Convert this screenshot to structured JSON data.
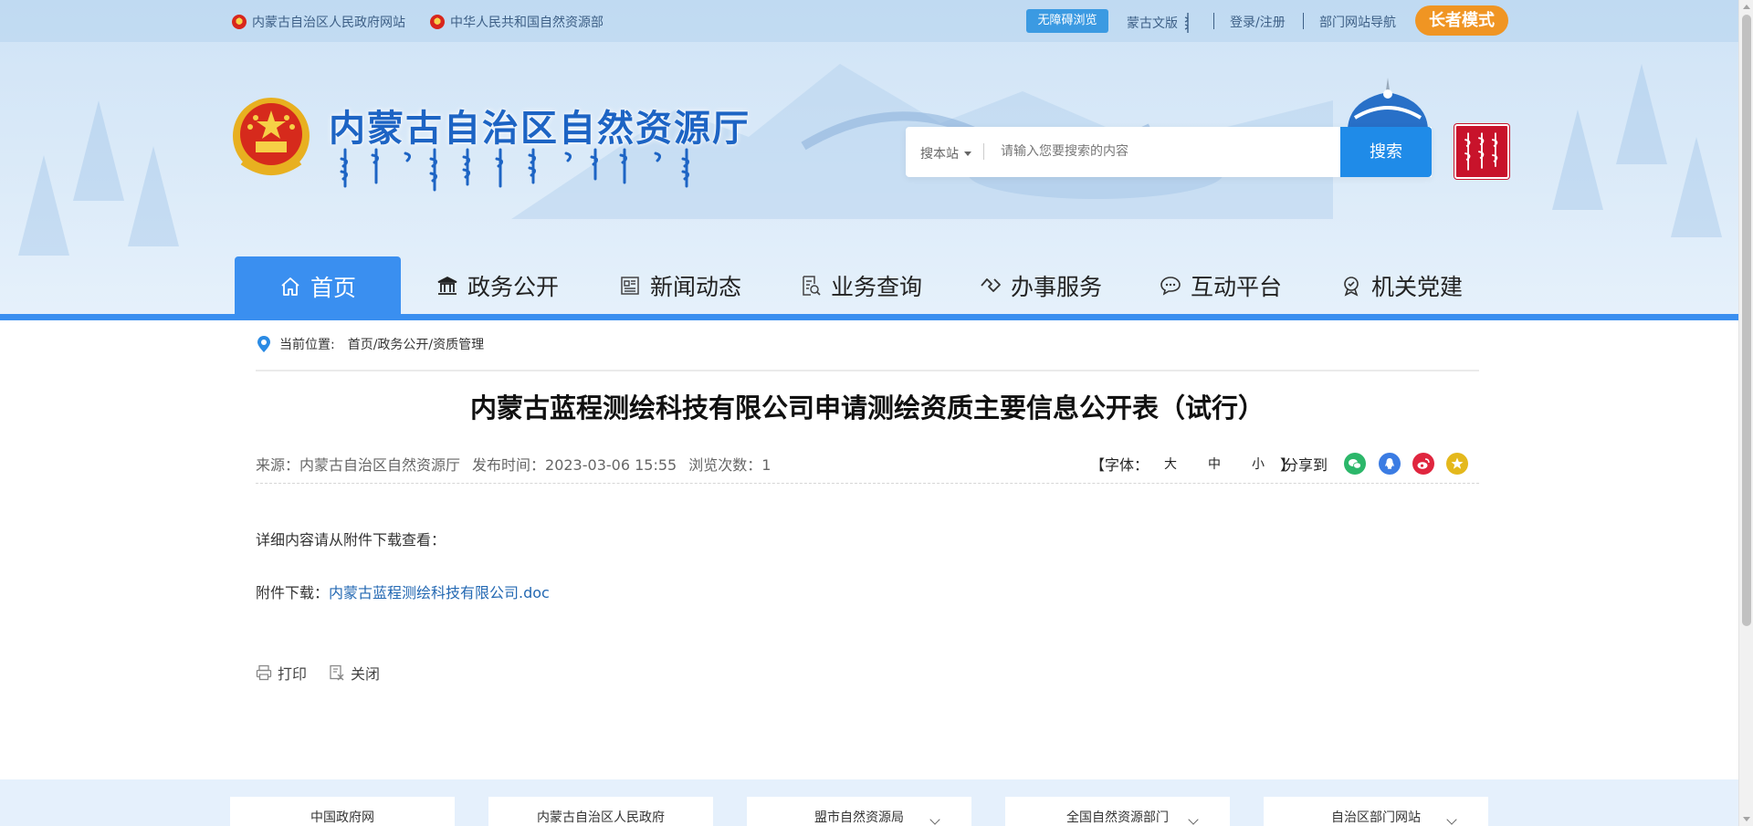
{
  "topbar": {
    "gov_site_link": "内蒙古自治区人民政府网站",
    "ministry_link": "中华人民共和国自然资源部",
    "accessible_btn": "无障碍浏览",
    "mongolian_version": "蒙古文版",
    "login": "登录/注册",
    "dept_nav": "部门网站导航",
    "elder_mode": "长者模式"
  },
  "header": {
    "site_title": "内蒙古自治区自然资源厅",
    "search_scope": "搜本站",
    "search_placeholder": "请输入您要搜索的内容",
    "search_button": "搜索"
  },
  "nav": {
    "items": [
      {
        "label": "首页",
        "icon": "home-icon",
        "active": true
      },
      {
        "label": "政务公开",
        "icon": "government-building-icon",
        "active": false
      },
      {
        "label": "新闻动态",
        "icon": "news-icon",
        "active": false
      },
      {
        "label": "业务查询",
        "icon": "document-search-icon",
        "active": false
      },
      {
        "label": "办事服务",
        "icon": "handshake-icon",
        "active": false
      },
      {
        "label": "互动平台",
        "icon": "chat-icon",
        "active": false
      },
      {
        "label": "机关党建",
        "icon": "party-badge-icon",
        "active": false
      }
    ]
  },
  "breadcrumb": {
    "label": "当前位置:",
    "path": "首页/政务公开/资质管理"
  },
  "article": {
    "title": "内蒙古蓝程测绘科技有限公司申请测绘资质主要信息公开表（试行）",
    "source": "来源：内蒙古自治区自然资源厅",
    "publish_time": "发布时间：2023-03-06 15:55",
    "views": "浏览次数：1",
    "font_label_open": "【字体：",
    "font_large": "大",
    "font_medium": "中",
    "font_small": "小",
    "font_label_close": "】",
    "share_label": "分享到",
    "intro": "详细内容请从附件下载查看：",
    "attachment_label": "附件下载：",
    "attachment_name": "内蒙古蓝程测绘科技有限公司.doc",
    "print": "打印",
    "close": "关闭"
  },
  "share_icons": [
    {
      "name": "wechat-icon",
      "color": "#2cb76a"
    },
    {
      "name": "qq-icon",
      "color": "#3b7ce3"
    },
    {
      "name": "weibo-icon",
      "color": "#e0263f"
    },
    {
      "name": "qzone-icon",
      "color": "#e4b81c"
    }
  ],
  "footer": {
    "links": [
      {
        "label": "中国政府网",
        "has_dropdown": false
      },
      {
        "label": "内蒙古自治区人民政府",
        "has_dropdown": false
      },
      {
        "label": "盟市自然资源局",
        "has_dropdown": true
      },
      {
        "label": "全国自然资源部门",
        "has_dropdown": true
      },
      {
        "label": "自治区部门网站",
        "has_dropdown": true
      }
    ]
  },
  "colors": {
    "primary_blue": "#3a8ff0",
    "title_blue": "#1d64c4",
    "elder_orange": "#f09523",
    "link_blue": "#2469b3"
  }
}
